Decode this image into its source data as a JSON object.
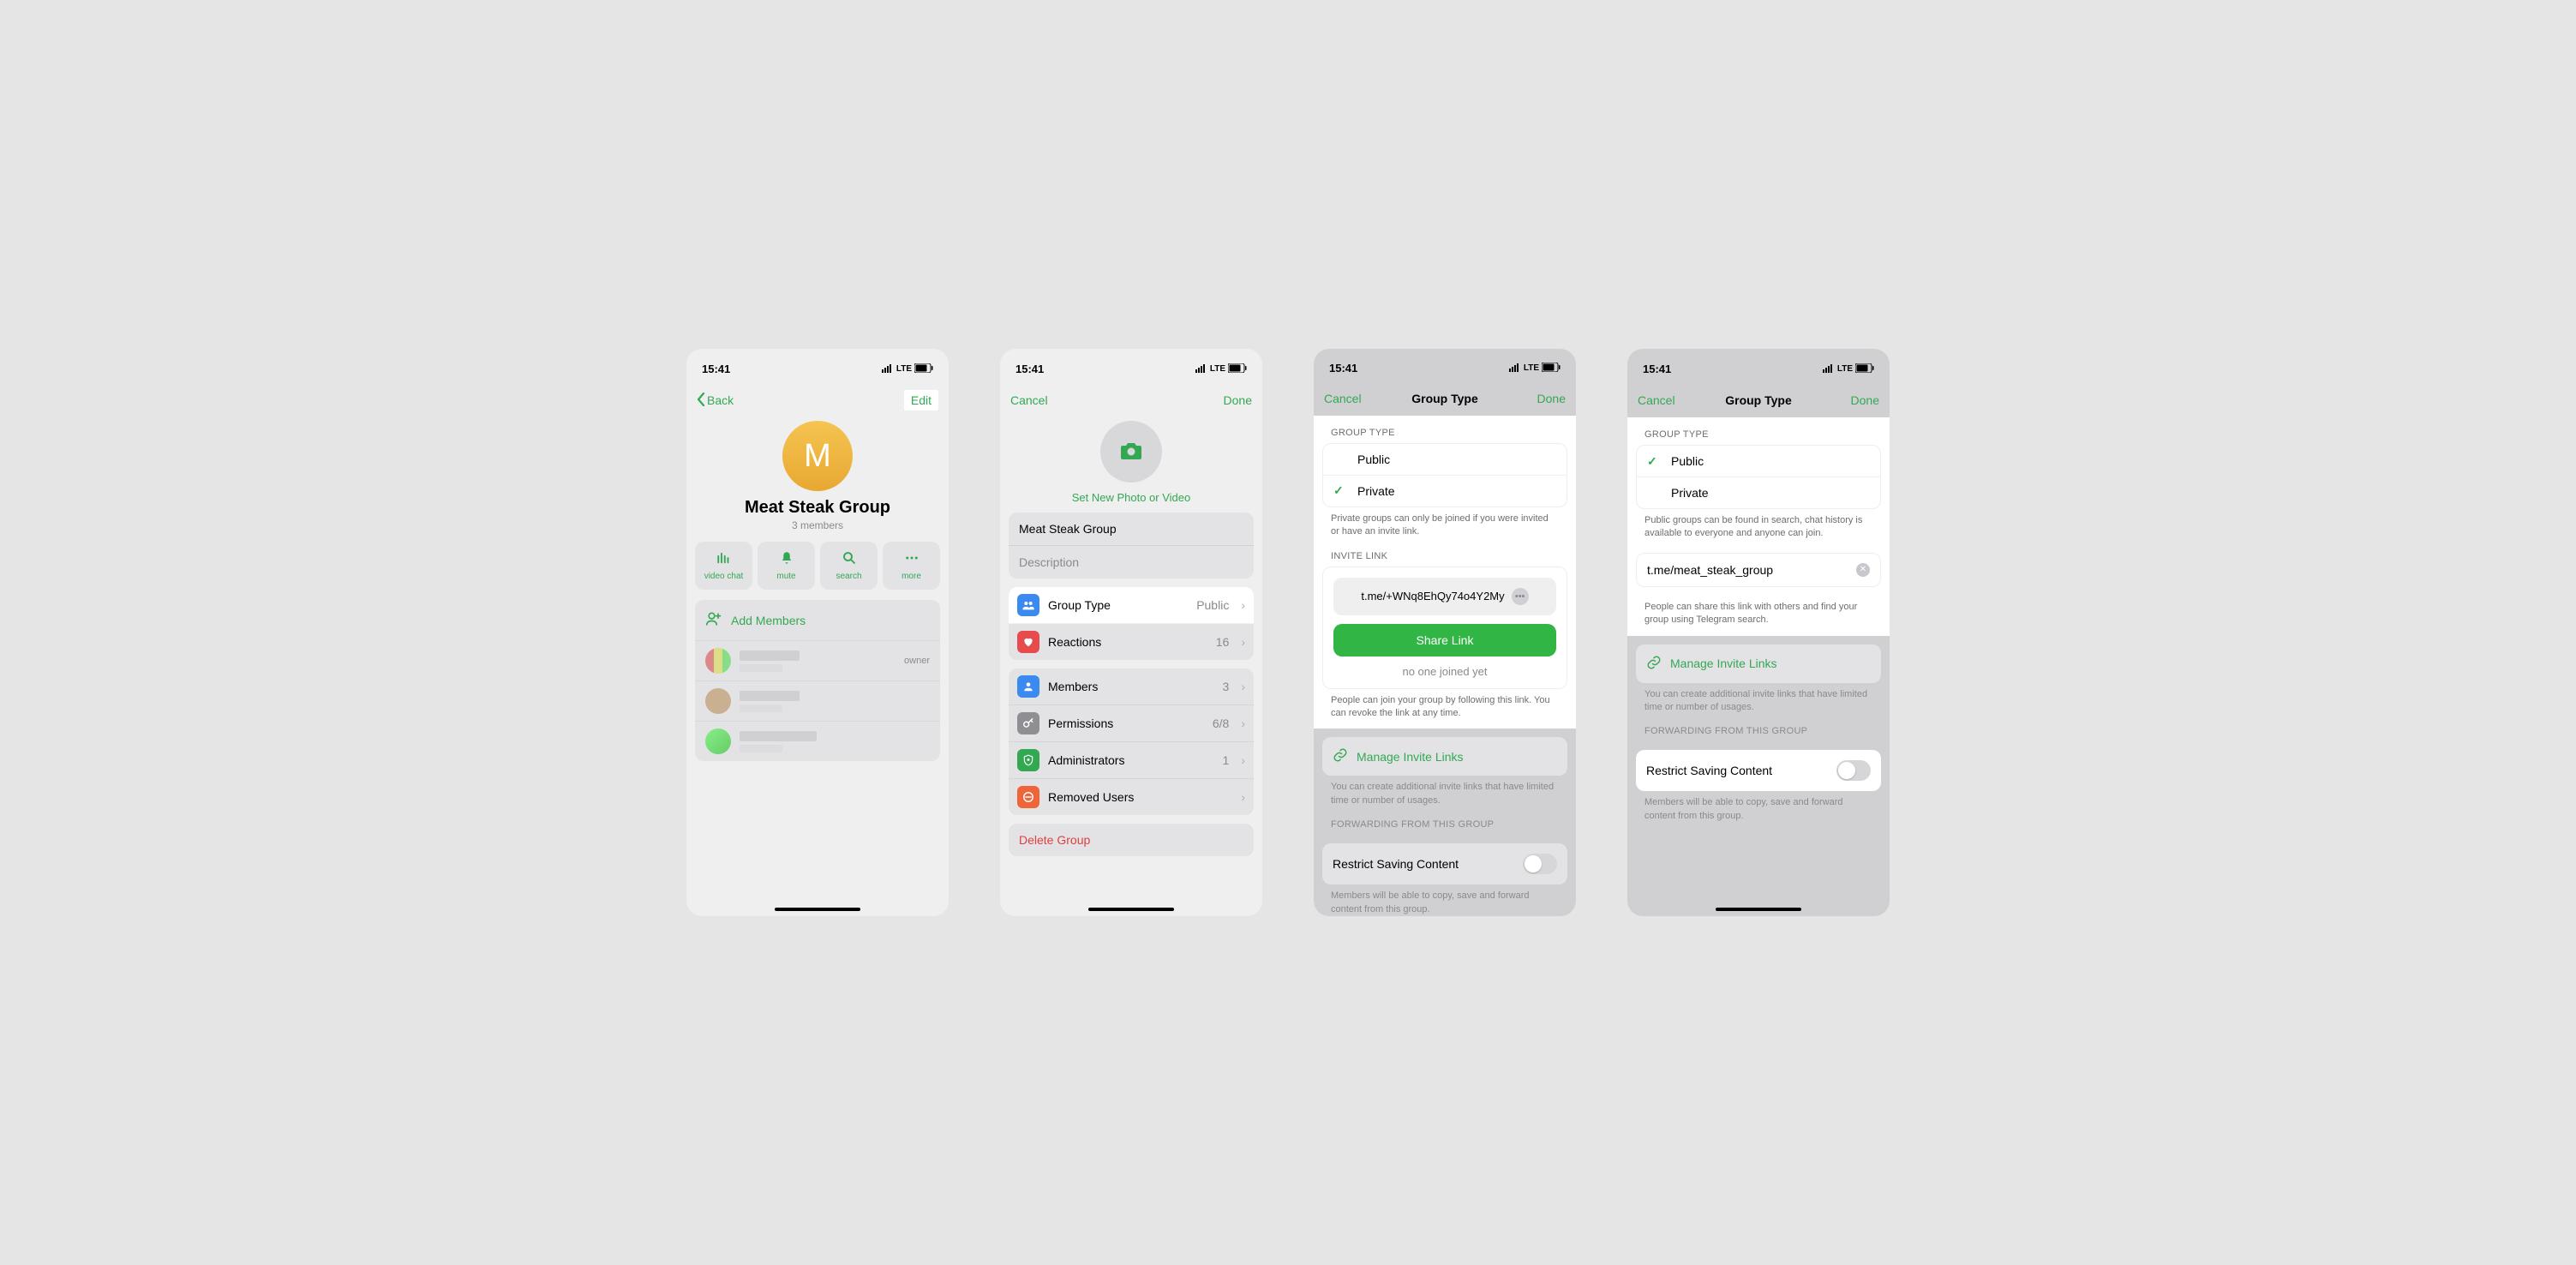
{
  "statusbar": {
    "time": "15:41",
    "net": "LTE"
  },
  "screen1": {
    "back": "Back",
    "edit": "Edit",
    "avatar_letter": "M",
    "group_name": "Meat Steak Group",
    "members_sub": "3 members",
    "actions": {
      "video": "video chat",
      "mute": "mute",
      "search": "search",
      "more": "more"
    },
    "add_members": "Add Members",
    "owner": "owner"
  },
  "screen2": {
    "cancel": "Cancel",
    "done": "Done",
    "set_photo": "Set New Photo or Video",
    "name_value": "Meat Steak Group",
    "desc_ph": "Description",
    "rows": {
      "group_type": {
        "label": "Group Type",
        "value": "Public"
      },
      "reactions": {
        "label": "Reactions",
        "value": "16"
      },
      "members": {
        "label": "Members",
        "value": "3"
      },
      "permissions": {
        "label": "Permissions",
        "value": "6/8"
      },
      "admins": {
        "label": "Administrators",
        "value": "1"
      },
      "removed": {
        "label": "Removed Users",
        "value": ""
      }
    },
    "delete": "Delete Group"
  },
  "screen3": {
    "cancel": "Cancel",
    "title": "Group Type",
    "done": "Done",
    "group_type_hdr": "GROUP TYPE",
    "public": "Public",
    "private": "Private",
    "private_note": "Private groups can only be joined if you were invited or have an invite link.",
    "invite_hdr": "INVITE LINK",
    "invite_link": "t.me/+WNq8EhQy74o4Y2My",
    "share": "Share Link",
    "no_one": "no one joined yet",
    "invite_note": "People can join your group by following this link. You can revoke the link at any time.",
    "manage": "Manage Invite Links",
    "manage_note": "You can create additional invite links that have limited time or number of usages.",
    "fwd_hdr": "FORWARDING FROM THIS GROUP",
    "restrict": "Restrict Saving Content",
    "restrict_note": "Members will be able to copy, save and forward content from this group."
  },
  "screen4": {
    "cancel": "Cancel",
    "title": "Group Type",
    "done": "Done",
    "group_type_hdr": "GROUP TYPE",
    "public": "Public",
    "private": "Private",
    "public_note": "Public groups can be found in search, chat history is available to everyone and anyone can join.",
    "link_value": "t.me/meat_steak_group",
    "link_note": "People can share this link with others and find your group using Telegram search.",
    "manage": "Manage Invite Links",
    "manage_note": "You can create additional invite links that have limited time or number of usages.",
    "fwd_hdr": "FORWARDING FROM THIS GROUP",
    "restrict": "Restrict Saving Content",
    "restrict_note": "Members will be able to copy, save and forward content from this group."
  }
}
